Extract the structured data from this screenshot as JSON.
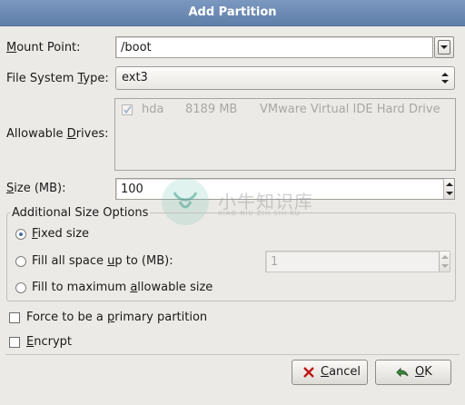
{
  "window": {
    "title": "Add Partition"
  },
  "mount_point": {
    "label_pre": "",
    "label_u": "M",
    "label_post": "ount Point:",
    "value": "/boot"
  },
  "fs_type": {
    "label_pre": "File System ",
    "label_u": "T",
    "label_post": "ype:",
    "value": "ext3"
  },
  "drives": {
    "label_pre": "Allowable ",
    "label_u": "D",
    "label_post": "rives:",
    "row": {
      "checked": true,
      "device": "hda",
      "size": "8189 MB",
      "model": "VMware Virtual IDE Hard Drive"
    }
  },
  "size": {
    "label_pre": "",
    "label_u": "S",
    "label_post": "ize (MB):",
    "value": "100"
  },
  "size_options": {
    "title": "Additional Size Options",
    "fixed": {
      "label_pre": "",
      "label_u": "F",
      "label_post": "ixed size",
      "selected": true
    },
    "fill_up_to": {
      "label_pre": "Fill all space ",
      "label_u": "u",
      "label_post": "p to (MB):",
      "selected": false,
      "value": "1"
    },
    "fill_max": {
      "label_pre": "Fill to maximum ",
      "label_u": "a",
      "label_post": "llowable size",
      "selected": false
    }
  },
  "primary": {
    "label_pre": "Force to be a ",
    "label_u": "p",
    "label_post": "rimary partition",
    "checked": false
  },
  "encrypt": {
    "label_pre": "",
    "label_u": "E",
    "label_post": "ncrypt",
    "checked": false
  },
  "buttons": {
    "cancel": {
      "label_pre": "",
      "label_u": "C",
      "label_post": "ancel"
    },
    "ok": {
      "label_pre": "",
      "label_u": "O",
      "label_post": "K"
    }
  },
  "watermark": {
    "title": "小牛知识库",
    "subtitle": "XIAO NIU ZHI SHI KU"
  },
  "colors": {
    "title_bar": "#6a88b3",
    "radio_selected": "#4a6fa5",
    "cancel_icon": "#c01818",
    "ok_icon": "#3a8a3a"
  },
  "icons": {
    "cancel": "x-icon",
    "ok": "check-arrow-icon",
    "combo": "chevron-down-icon"
  }
}
